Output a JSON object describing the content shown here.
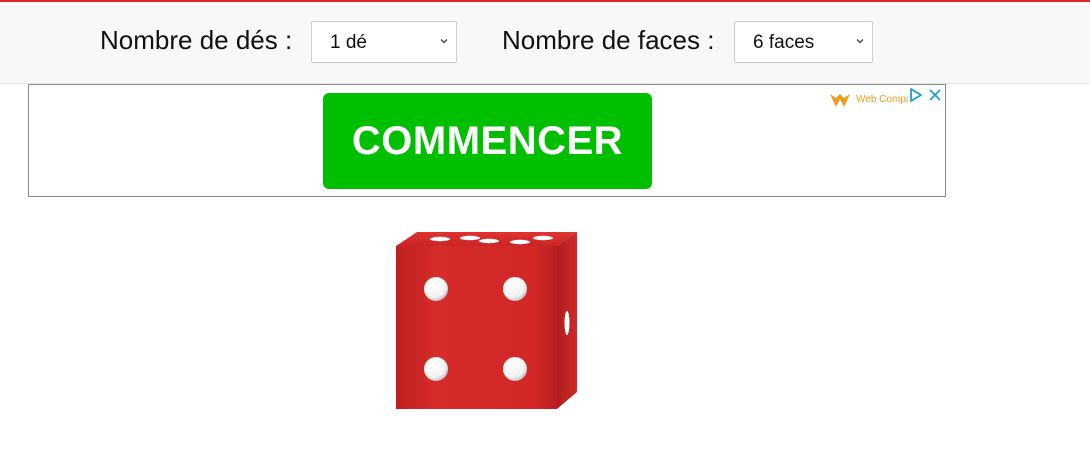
{
  "colors": {
    "accent_red": "#d9262a",
    "toolbar_bg": "#f8f8f8",
    "ad_button_green": "#00bf00",
    "ad_brand_orange": "#f29a1c",
    "ad_icon_blue": "#1a9fd8",
    "die_red": "#d42a2a"
  },
  "toolbar": {
    "dice_count_label": "Nombre de dés :",
    "dice_count_value": "1 dé",
    "faces_label": "Nombre de faces :",
    "faces_value": "6 faces"
  },
  "ad": {
    "button_label": "COMMENCER",
    "brand_text": "Web Compass",
    "icons": [
      "web-compass-logo-icon",
      "ad-choices-icon",
      "ad-close-icon"
    ]
  },
  "die": {
    "front_value": 4,
    "icon": "die-icon"
  }
}
